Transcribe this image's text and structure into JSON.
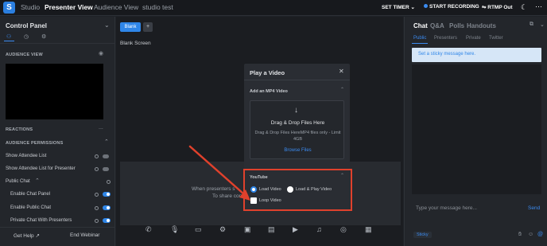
{
  "topbar": {
    "nav": [
      "Studio",
      "Presenter View",
      "Audience View",
      "studio test"
    ],
    "set_timer": "SET TIMER",
    "start_recording": "START RECORDING",
    "rtmp_out": "RTMP Out",
    "accent_color": "#2f86e8"
  },
  "left_panel": {
    "title": "Control Panel",
    "audience_view": "AUDIENCE VIEW",
    "reactions": "REACTIONS",
    "reactions_more": "...",
    "audience_permissions": "AUDIENCE PERMISSIONS",
    "rows": [
      {
        "label": "Show Attendee List",
        "state": "off"
      },
      {
        "label": "Show Attendee List for Presenter",
        "state": "off"
      }
    ],
    "public_chat": "Public Chat",
    "chat_rows": [
      {
        "label": "Enable Chat Panel",
        "state": "on"
      },
      {
        "label": "Enable Public Chat",
        "state": "on"
      },
      {
        "label": "Private Chat With Presenters",
        "state": "on"
      }
    ],
    "get_help": "Get Help",
    "end_webinar": "End Webinar"
  },
  "center": {
    "blank_button": "Blank",
    "add_button": "+",
    "blank_screen": "Blank Screen",
    "partial_text_1": "When presenters s",
    "partial_text_2": "To share cont"
  },
  "modal": {
    "title": "Play a Video",
    "add_mp4": "Add an MP4 Video",
    "drag_drop": "Drag & Drop Files Here",
    "drop_hint": "Drag & Drop Files HereMP4 files only - Limit 4GB",
    "browse": "Browse Files",
    "youtube": "YouTube",
    "load_video": "Load Video",
    "load_play": "Load & Play Video",
    "loop_video": "Loop Video"
  },
  "right_panel": {
    "tabs": [
      "Chat",
      "Q&A",
      "Polls",
      "Handouts"
    ],
    "subtabs": [
      "Public",
      "Presenters",
      "Private",
      "Twitter"
    ],
    "sticky_placeholder": "Set a sticky message here.",
    "message_placeholder": "Type your message here...",
    "send": "Send",
    "sticky_badge": "Sticky"
  },
  "icons": [
    "settings-icon",
    "moon-icon",
    "more-icon",
    "phone-icon",
    "mic-icon",
    "camera-icon",
    "gear-icon",
    "slides-icon",
    "text-icon",
    "video-icon",
    "music-icon",
    "broadcast-icon",
    "notes-icon"
  ]
}
